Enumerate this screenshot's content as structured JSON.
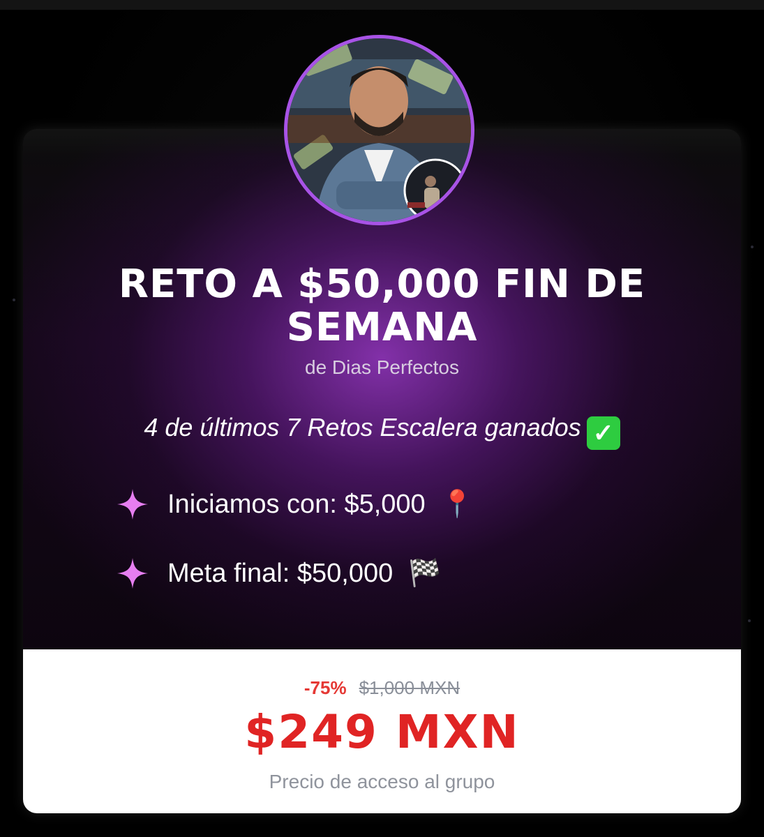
{
  "offer": {
    "title": "RETO A $50,000 FIN DE SEMANA",
    "author": "de Dias Perfectos",
    "record_text": "4 de últimos 7 Retos Escalera ganados",
    "features": [
      {
        "label": "Iniciamos con: $5,000",
        "emoji": "📍",
        "icon": "sparkle-icon"
      },
      {
        "label": "Meta final: $50,000",
        "emoji": "🏁",
        "icon": "sparkle-icon"
      }
    ]
  },
  "pricing": {
    "discount": "-75%",
    "original_price": "$1,000 MXN",
    "price": "$249 MXN",
    "note": "Precio de acceso al grupo"
  },
  "colors": {
    "avatar_ring": "#a853e6",
    "glow": "#a23cd2",
    "sparkle": "#e67ef0",
    "price_red": "#e02424",
    "check_green": "#2ecc40"
  }
}
